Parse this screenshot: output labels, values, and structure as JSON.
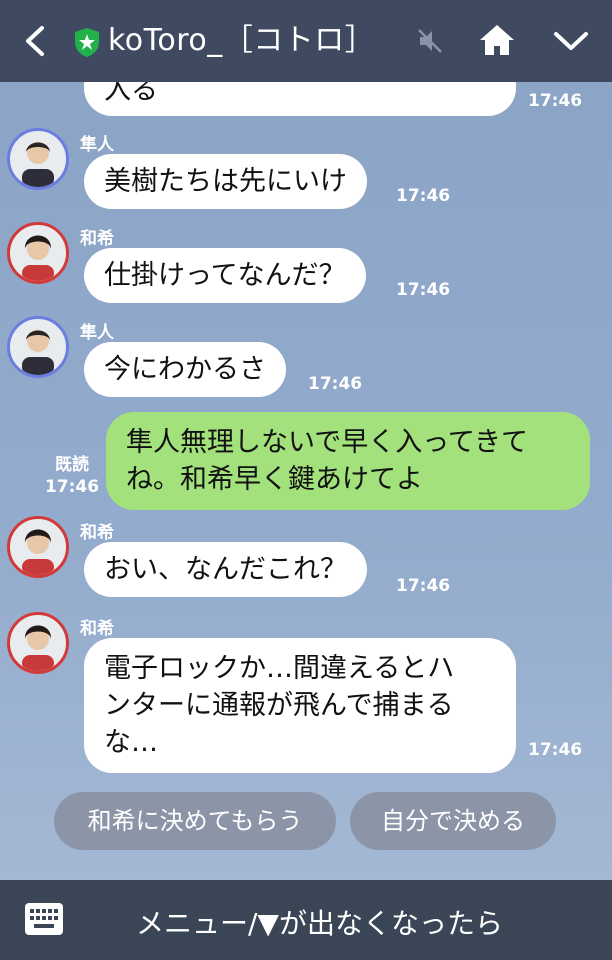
{
  "header": {
    "title": "koToro_［コトロ］",
    "icons": [
      "back-chevron-icon",
      "official-shield-icon",
      "mute-icon",
      "home-icon",
      "chevron-down-icon"
    ]
  },
  "messages": [
    {
      "side": "left",
      "text": "入る",
      "time": "17:46"
    },
    {
      "side": "left",
      "sender": "隼人",
      "text": "美樹たちは先にいけ",
      "time": "17:46"
    },
    {
      "side": "left",
      "sender": "和希",
      "text": "仕掛けってなんだ？",
      "time": "17:46"
    },
    {
      "side": "left",
      "sender": "隼人",
      "text": "今にわかるさ",
      "time": "17:46"
    },
    {
      "side": "right",
      "read": "既読",
      "time": "17:46",
      "lines": [
        "隼人無理しないで早く入ってきて",
        "ね。和希早く鍵あけてよ"
      ]
    },
    {
      "side": "left",
      "sender": "和希",
      "text": "おい、なんだこれ？",
      "time": "17:46"
    },
    {
      "side": "left",
      "sender": "和希",
      "time": "17:46",
      "lines": [
        "電子ロックか…間違えるとハ",
        "ンターに通報が飛んで捕まる",
        "な…"
      ]
    }
  ],
  "choices": [
    "和希に決めてもらう",
    "自分で決める"
  ],
  "bottom": {
    "menu_text": "メニュー/▼が出なくなったら",
    "icon": "keyboard-icon"
  }
}
